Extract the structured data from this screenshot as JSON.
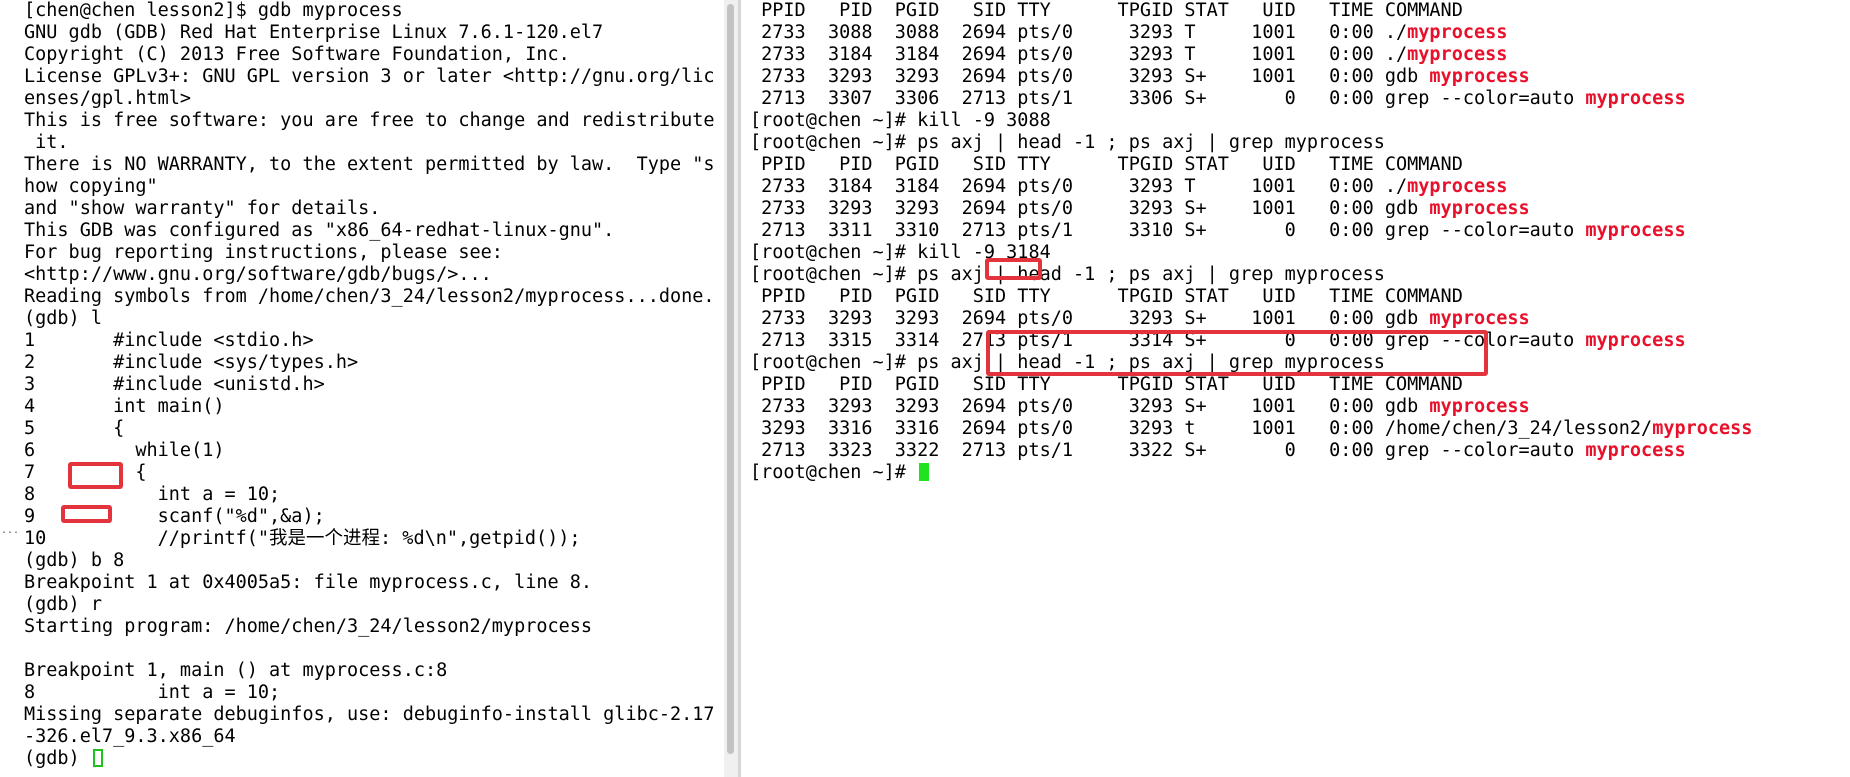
{
  "left_terminal": {
    "lines": [
      "[chen@chen lesson2]$ gdb myprocess",
      "GNU gdb (GDB) Red Hat Enterprise Linux 7.6.1-120.el7",
      "Copyright (C) 2013 Free Software Foundation, Inc.",
      "License GPLv3+: GNU GPL version 3 or later <http://gnu.org/lic",
      "enses/gpl.html>",
      "This is free software: you are free to change and redistribute",
      " it.",
      "There is NO WARRANTY, to the extent permitted by law.  Type \"s",
      "how copying\"",
      "and \"show warranty\" for details.",
      "This GDB was configured as \"x86_64-redhat-linux-gnu\".",
      "For bug reporting instructions, please see:",
      "<http://www.gnu.org/software/gdb/bugs/>...",
      "Reading symbols from /home/chen/3_24/lesson2/myprocess...done.",
      "(gdb) l",
      "1       #include <stdio.h>",
      "2       #include <sys/types.h>",
      "3       #include <unistd.h>",
      "4       int main()",
      "5       {",
      "6         while(1)",
      "7         {",
      "8           int a = 10;",
      "9           scanf(\"%d\",&a);",
      "10          //printf(\"我是一个进程: %d\\n\",getpid());",
      "(gdb) b 8",
      "Breakpoint 1 at 0x4005a5: file myprocess.c, line 8.",
      "(gdb) r",
      "Starting program: /home/chen/3_24/lesson2/myprocess",
      "",
      "Breakpoint 1, main () at myprocess.c:8",
      "8           int a = 10;",
      "Missing separate debuginfos, use: debuginfo-install glibc-2.17",
      "-326.el7_9.3.x86_64"
    ],
    "prompt": "(gdb) "
  },
  "right_terminal": {
    "lines": [
      [
        " PPID   PID  PGID   SID TTY      TPGID STAT   UID   TIME COMMAND"
      ],
      [
        " 2733  3088  3088  2694 pts/0     3293 T     1001   0:00 ./",
        "myprocess"
      ],
      [
        " 2733  3184  3184  2694 pts/0     3293 T     1001   0:00 ./",
        "myprocess"
      ],
      [
        " 2733  3293  3293  2694 pts/0     3293 S+    1001   0:00 gdb ",
        "myprocess"
      ],
      [
        " 2713  3307  3306  2713 pts/1     3306 S+       0   0:00 grep --color=auto ",
        "myprocess"
      ],
      [
        "[root@chen ~]# kill -9 3088"
      ],
      [
        "[root@chen ~]# ps axj | head -1 ; ps axj | grep myprocess"
      ],
      [
        " PPID   PID  PGID   SID TTY      TPGID STAT   UID   TIME COMMAND"
      ],
      [
        " 2733  3184  3184  2694 pts/0     3293 T     1001   0:00 ./",
        "myprocess"
      ],
      [
        " 2733  3293  3293  2694 pts/0     3293 S+    1001   0:00 gdb ",
        "myprocess"
      ],
      [
        " 2713  3311  3310  2713 pts/1     3310 S+       0   0:00 grep --color=auto ",
        "myprocess"
      ],
      [
        "[root@chen ~]# kill -9 3184"
      ],
      [
        "[root@chen ~]# ps axj | head -1 ; ps axj | grep myprocess"
      ],
      [
        " PPID   PID  PGID   SID TTY      TPGID STAT   UID   TIME COMMAND"
      ],
      [
        " 2733  3293  3293  2694 pts/0     3293 S+    1001   0:00 gdb ",
        "myprocess"
      ],
      [
        " 2713  3315  3314  2713 pts/1     3314 S+       0   0:00 grep --color=auto ",
        "myprocess"
      ],
      [
        "[root@chen ~]# ps axj | head -1 ; ps axj | grep myprocess"
      ],
      [
        " PPID   PID  PGID   SID TTY      TPGID STAT   UID   TIME COMMAND"
      ],
      [
        " 2733  3293  3293  2694 pts/0     3293 S+    1001   0:00 gdb ",
        "myprocess"
      ],
      [
        " 3293  3316  3316  2694 pts/0     3293 t     1001   0:00 /home/chen/3_24/lesson2/",
        "myprocess"
      ],
      [
        " 2713  3323  3322  2713 pts/1     3322 S+       0   0:00 grep --color=auto ",
        "myprocess"
      ]
    ],
    "prompt": "[root@chen ~]# "
  },
  "colors": {
    "highlight": "#e8102a",
    "annotation_box": "#e3343d",
    "cursor": "#1ee31e"
  },
  "icons": {
    "edge_marker": "ellipsis-icon",
    "edge_marker_text": "..."
  }
}
